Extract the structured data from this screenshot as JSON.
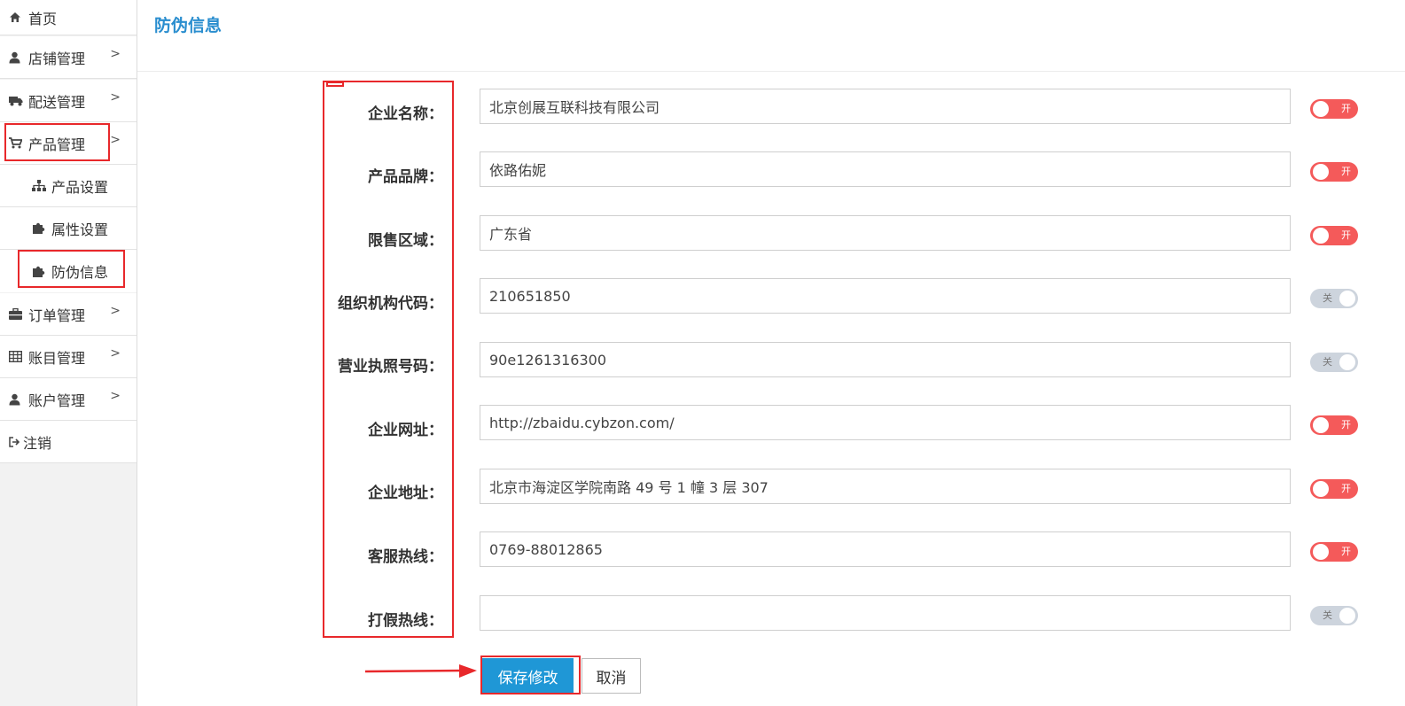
{
  "sidebar": {
    "items": [
      {
        "label": "首页",
        "icon": "home-icon"
      },
      {
        "label": "店铺管理",
        "icon": "user-icon"
      },
      {
        "label": "配送管理",
        "icon": "truck-icon"
      },
      {
        "label": "产品管理",
        "icon": "cart-icon"
      },
      {
        "label": "订单管理",
        "icon": "briefcase-icon"
      },
      {
        "label": "账目管理",
        "icon": "table-icon"
      },
      {
        "label": "账户管理",
        "icon": "user-icon"
      },
      {
        "label": "注销",
        "icon": "sign-out-icon"
      }
    ],
    "subitems": [
      {
        "label": "产品设置",
        "icon": "sitemap-icon"
      },
      {
        "label": "属性设置",
        "icon": "puzzle-icon"
      },
      {
        "label": "防伪信息",
        "icon": "puzzle-icon"
      }
    ],
    "chevron": ">"
  },
  "header": {
    "title": "防伪信息"
  },
  "form": {
    "fields": [
      {
        "label": "企业名称：",
        "value": "北京创展互联科技有限公司",
        "toggle": "开",
        "on": true
      },
      {
        "label": "产品品牌：",
        "value": "依路佑妮",
        "toggle": "开",
        "on": true
      },
      {
        "label": "限售区域：",
        "value": "广东省",
        "toggle": "开",
        "on": true
      },
      {
        "label": "组织机构代码：",
        "value": "210651850",
        "toggle": "关",
        "on": false
      },
      {
        "label": "营业执照号码：",
        "value": "90e1261316300",
        "toggle": "关",
        "on": false
      },
      {
        "label": "企业网址：",
        "value": "http://zbaidu.cybzon.com/",
        "toggle": "开",
        "on": true
      },
      {
        "label": "企业地址：",
        "value": "北京市海淀区学院南路 49 号 1 幢 3 层 307",
        "toggle": "开",
        "on": true
      },
      {
        "label": "客服热线：",
        "value": "0769-88012865",
        "toggle": "开",
        "on": true
      },
      {
        "label": "打假热线：",
        "value": "",
        "toggle": "关",
        "on": false
      }
    ]
  },
  "actions": {
    "save_label": "保存修改",
    "cancel_label": "取消"
  },
  "colors": {
    "accent": "#2a8ecf",
    "toggle_on": "#f45a5a",
    "toggle_off": "#cdd4dd",
    "annotation": "#e8282b"
  }
}
